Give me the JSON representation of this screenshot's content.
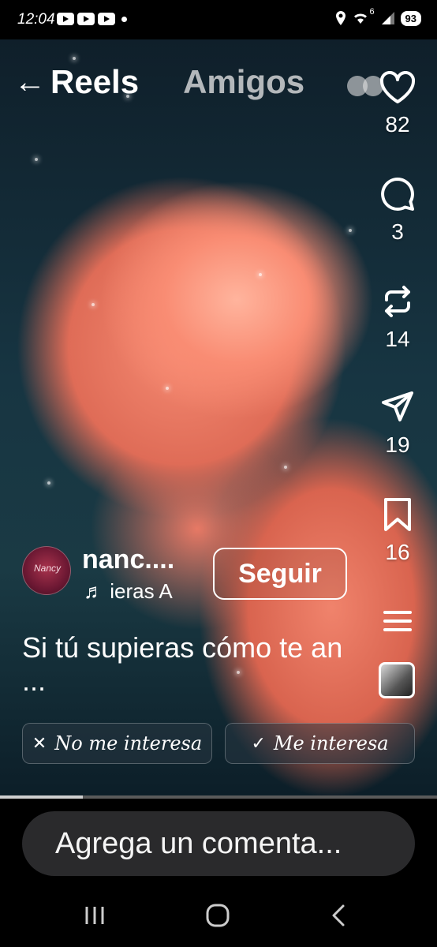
{
  "status": {
    "time": "12:04",
    "network": "6",
    "battery": "93"
  },
  "topnav": {
    "back": "←",
    "tab_reels": "Reels",
    "tab_amigos": "Amigos"
  },
  "actions": {
    "likes": "82",
    "comments": "3",
    "reposts": "14",
    "shares": "19",
    "saves": "16"
  },
  "author": {
    "avatar_text": "Nancy",
    "username": "nanc....",
    "music": "♬ ieras  A",
    "follow_label": "Seguir"
  },
  "caption": "Si tú supieras cómo te an ...",
  "interest": {
    "not_interested_glyph": "✕",
    "not_interested": "No me interesa",
    "interested_glyph": "✓",
    "interested": "Me interesa"
  },
  "progress": 0.19,
  "comment_placeholder": "Agrega un comenta...",
  "colors": {
    "accent": "#ffffff",
    "comment_bg": "#2a2a2c",
    "rose": "#f58a72"
  }
}
